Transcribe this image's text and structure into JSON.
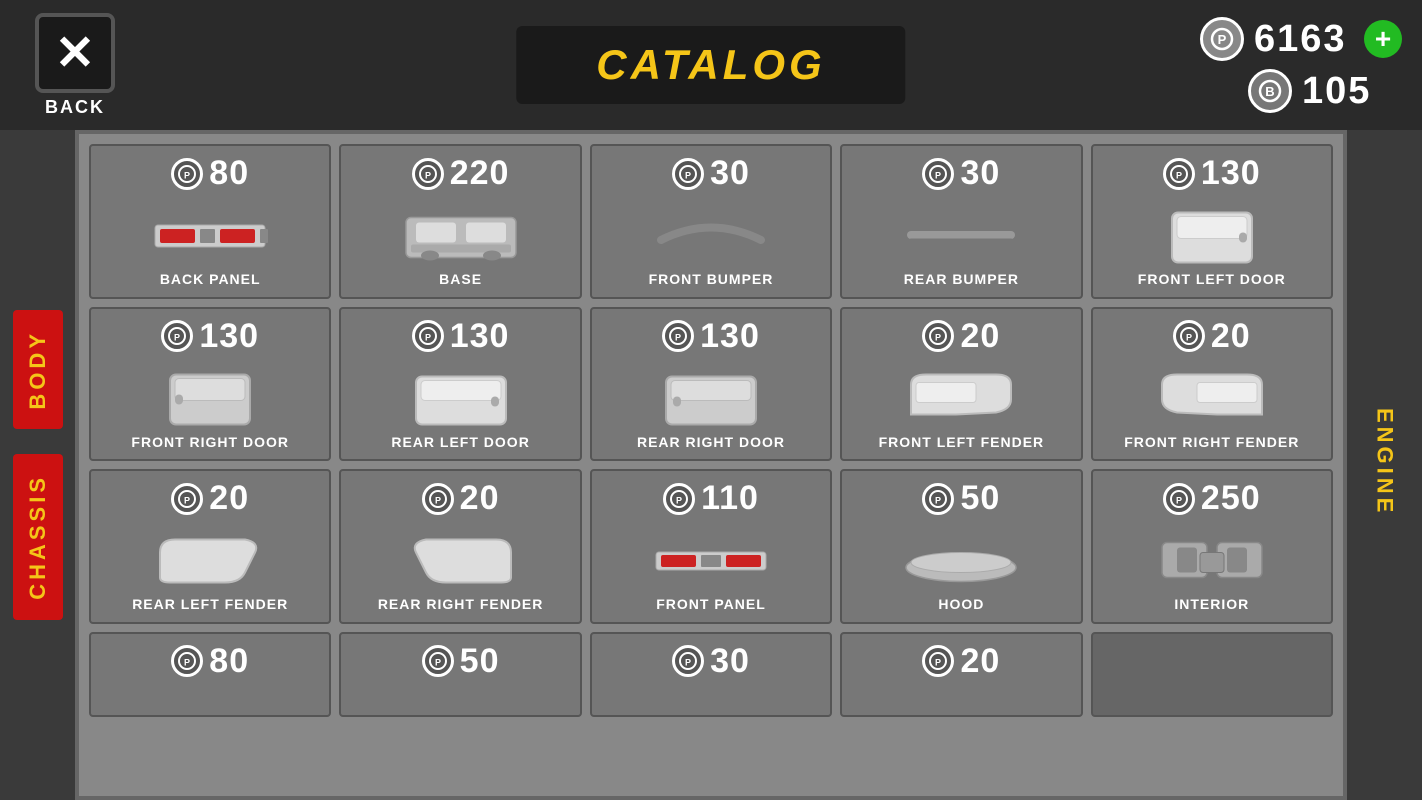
{
  "header": {
    "back_label": "BACK",
    "title": "CATALOG",
    "currency_gold": "6163",
    "currency_bitcoin": "105",
    "add_label": "+"
  },
  "sidebar_left": {
    "body_label": "BODY",
    "chassis_label": "CHASSIS"
  },
  "sidebar_right": {
    "engine_label": "ENGINE"
  },
  "items": [
    {
      "id": "back-panel",
      "price": "80",
      "name": "BACK PANEL",
      "color": "#cc2222"
    },
    {
      "id": "base",
      "price": "220",
      "name": "BASE",
      "color": "#aaaaaa"
    },
    {
      "id": "front-bumper",
      "price": "30",
      "name": "FRONT BUMPER",
      "color": "#888888"
    },
    {
      "id": "rear-bumper",
      "price": "30",
      "name": "REAR BUMPER",
      "color": "#888888"
    },
    {
      "id": "front-left-door",
      "price": "130",
      "name": "FRONT LEFT DOOR",
      "color": "#dddddd"
    },
    {
      "id": "front-right-door",
      "price": "130",
      "name": "FRONT RIGHT DOOR",
      "color": "#dddddd"
    },
    {
      "id": "rear-left-door",
      "price": "130",
      "name": "REAR LEFT DOOR",
      "color": "#dddddd"
    },
    {
      "id": "rear-right-door",
      "price": "130",
      "name": "REAR RIGHT DOOR",
      "color": "#dddddd"
    },
    {
      "id": "front-left-fender",
      "price": "20",
      "name": "FRONT LEFT FENDER",
      "color": "#dddddd"
    },
    {
      "id": "front-right-fender",
      "price": "20",
      "name": "FRONT RIGHT FENDER",
      "color": "#dddddd"
    },
    {
      "id": "rear-left-fender",
      "price": "20",
      "name": "REAR LEFT FENDER",
      "color": "#dddddd"
    },
    {
      "id": "rear-right-fender",
      "price": "20",
      "name": "REAR RIGHT FENDER",
      "color": "#dddddd"
    },
    {
      "id": "front-panel",
      "price": "110",
      "name": "FRONT PANEL",
      "color": "#cc2222"
    },
    {
      "id": "hood",
      "price": "50",
      "name": "HOOD",
      "color": "#bbbbbb"
    },
    {
      "id": "interior",
      "price": "250",
      "name": "INTERIOR",
      "color": "#aaaaaa"
    },
    {
      "id": "item-row4-1",
      "price": "80",
      "name": "",
      "partial": true
    },
    {
      "id": "item-row4-2",
      "price": "50",
      "name": "",
      "partial": true
    },
    {
      "id": "item-row4-3",
      "price": "30",
      "name": "",
      "partial": true
    },
    {
      "id": "item-row4-4",
      "price": "20",
      "name": "",
      "partial": true
    }
  ]
}
